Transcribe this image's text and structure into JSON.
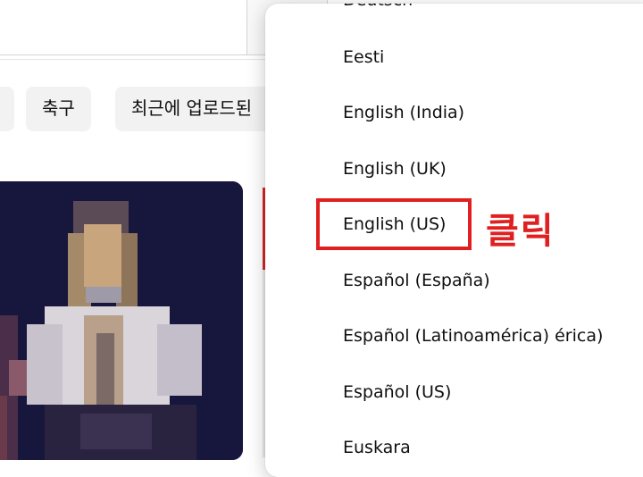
{
  "chips": [
    {
      "label": ""
    },
    {
      "label": "축구"
    },
    {
      "label": "최근에 업로드된"
    }
  ],
  "language_menu": {
    "items": [
      {
        "label": "Deutsch"
      },
      {
        "label": "Eesti"
      },
      {
        "label": "English (India)"
      },
      {
        "label": "English (UK)"
      },
      {
        "label": "English (US)"
      },
      {
        "label": "Español (España)"
      },
      {
        "label": "Español (Latinoamérica) érica)"
      },
      {
        "label": "Español (US)"
      },
      {
        "label": "Euskara"
      }
    ],
    "highlighted": "English (US)"
  },
  "annotation": {
    "label": "클릭",
    "color": "#e02020"
  }
}
